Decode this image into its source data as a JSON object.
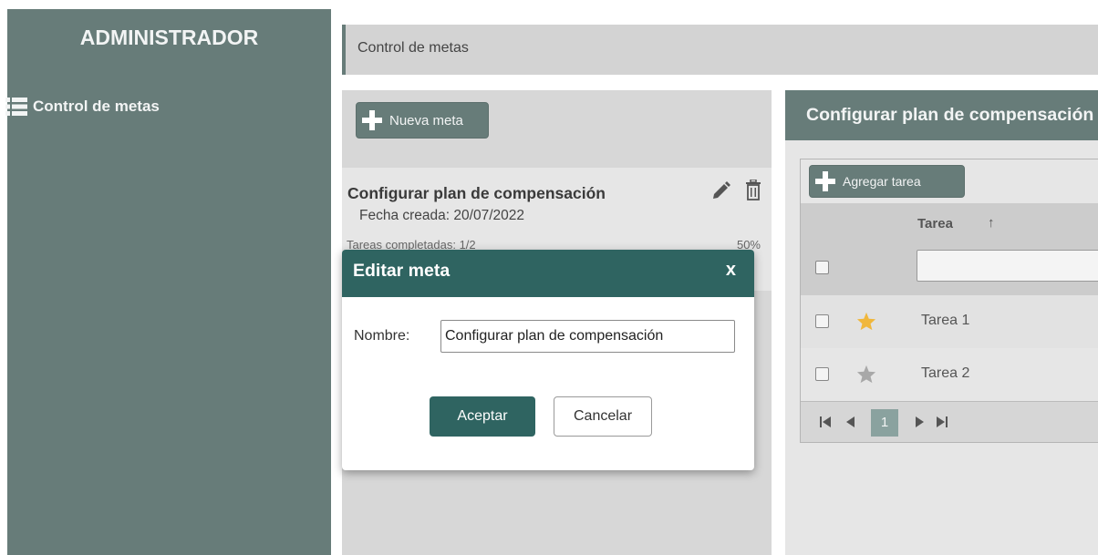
{
  "sidebar": {
    "title": "ADMINISTRADOR",
    "items": [
      {
        "label": "Control de metas",
        "icon": "list-icon"
      }
    ]
  },
  "breadcrumb": {
    "text": "Control de metas"
  },
  "goals_panel": {
    "new_goal_label": "Nueva meta",
    "goal": {
      "title": "Configurar plan de compensación",
      "date_label": "Fecha creada:",
      "date_value": "20/07/2022",
      "tasks_label": "Tareas completadas: 1/2",
      "progress_pct": "50%"
    }
  },
  "tasks_panel": {
    "title": "Configurar plan de compensación",
    "add_task_label": "Agregar tarea",
    "column_task": "Tarea",
    "sort_indicator": "↑",
    "rows": [
      {
        "label": "Tarea 1",
        "starred": true
      },
      {
        "label": "Tarea 2",
        "starred": false
      }
    ],
    "pager": {
      "current_page": "1",
      "first": "⏮",
      "prev": "◀",
      "next": "▶",
      "last": "⏭"
    }
  },
  "dialog": {
    "title": "Editar meta",
    "close_label": "x",
    "name_label": "Nombre:",
    "name_value": "Configurar plan de compensación",
    "accept_label": "Aceptar",
    "cancel_label": "Cancelar"
  },
  "colors": {
    "sidebar_bg": "#677c79",
    "dialog_header": "#2f6461",
    "star_active": "#f0b73c",
    "star_inactive": "#a8a8a8"
  }
}
